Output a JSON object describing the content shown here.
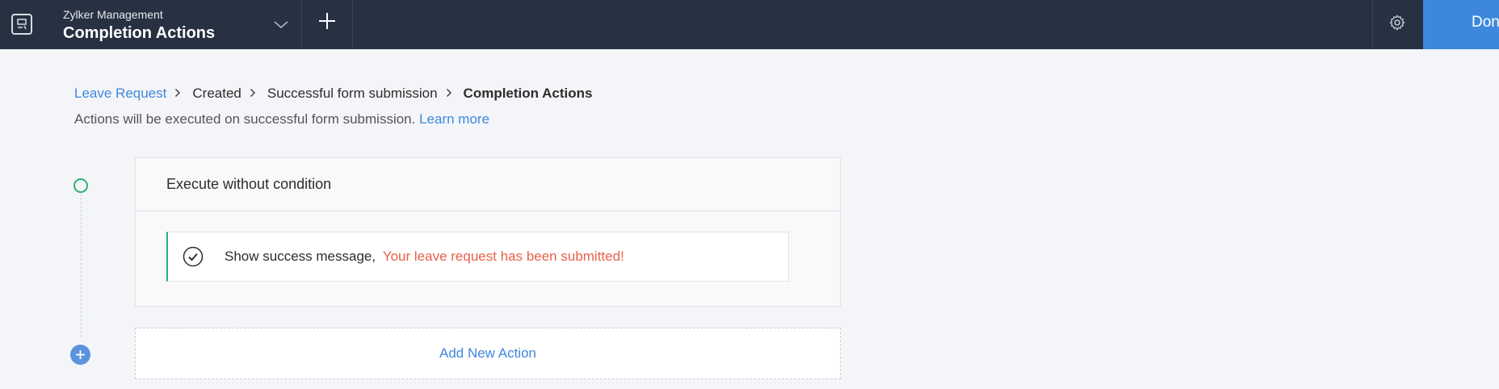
{
  "topbar": {
    "app_name": "Zylker Management",
    "page_title": "Completion Actions",
    "done_label": "Done",
    "icons": [
      "app-form-icon",
      "chevron-down-icon",
      "plus-icon",
      "gear-icon"
    ],
    "background": "#273142",
    "done_color": "#3d88dc"
  },
  "breadcrumb": {
    "items": [
      {
        "label": "Leave Request",
        "link": true
      },
      {
        "label": "Created",
        "link": false
      },
      {
        "label": "Successful form submission",
        "link": false
      },
      {
        "label": "Completion Actions",
        "current": true
      }
    ],
    "separator_icon": "chevron-right-icon"
  },
  "info": {
    "text": "Actions will be executed on successful form submission.",
    "link_label": "Learn more"
  },
  "condition": {
    "title": "Execute without condition",
    "actions": [
      {
        "icon": "check-circle-icon",
        "label": "Show success message,",
        "message": "Your leave request has been submitted!"
      }
    ]
  },
  "add_action": {
    "label": "Add New Action",
    "icon": "plus-circle-icon"
  },
  "colors": {
    "accent": "#3d88dc",
    "success": "#2fae73",
    "message": "#e8614a"
  }
}
